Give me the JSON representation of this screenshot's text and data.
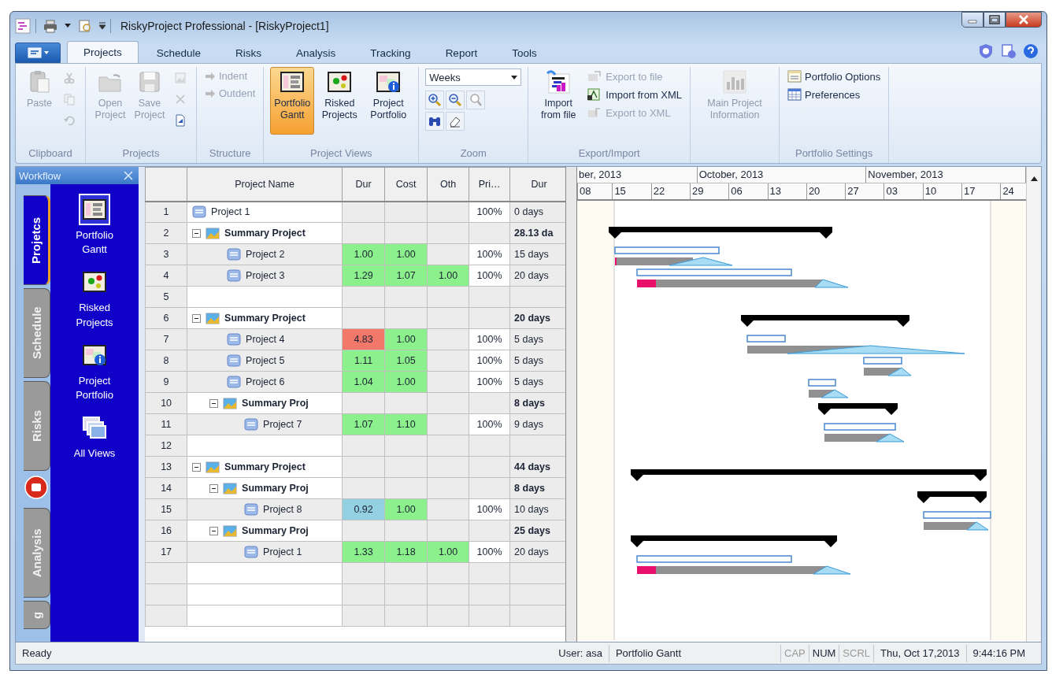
{
  "window": {
    "title": "RiskyProject Professional - [RiskyProject1]"
  },
  "ribbon_tabs": [
    {
      "label": "Projects",
      "selected": true
    },
    {
      "label": "Schedule",
      "selected": false
    },
    {
      "label": "Risks",
      "selected": false
    },
    {
      "label": "Analysis",
      "selected": false
    },
    {
      "label": "Tracking",
      "selected": false
    },
    {
      "label": "Report",
      "selected": false
    },
    {
      "label": "Tools",
      "selected": false
    }
  ],
  "ribbon": {
    "groups": [
      {
        "label": "Clipboard",
        "items": [
          {
            "kind": "large",
            "label": "Paste",
            "disabled": true
          },
          {
            "kind": "icon",
            "disabled": true
          },
          {
            "kind": "icon",
            "disabled": true
          },
          {
            "kind": "icon",
            "disabled": true
          }
        ]
      },
      {
        "label": "Projects",
        "items": [
          {
            "kind": "large",
            "label": "Open Project",
            "disabled": true
          },
          {
            "kind": "large",
            "label": "Save Project",
            "disabled": true
          },
          {
            "kind": "icon",
            "disabled": true
          },
          {
            "kind": "icon",
            "disabled": true
          },
          {
            "kind": "icon",
            "disabled": false
          }
        ]
      },
      {
        "label": "Structure",
        "items": [
          {
            "kind": "small",
            "label": "Indent",
            "disabled": true
          },
          {
            "kind": "small",
            "label": "Outdent",
            "disabled": true
          }
        ]
      },
      {
        "label": "Project Views",
        "items": [
          {
            "kind": "large",
            "label": "Portfolio Gantt",
            "disabled": false,
            "selected": true
          },
          {
            "kind": "large",
            "label": "Risked Projects",
            "disabled": false,
            "selected": false
          },
          {
            "kind": "large",
            "label": "Project Portfolio",
            "disabled": false,
            "selected": false
          }
        ]
      },
      {
        "label": "Zoom",
        "items": [
          {
            "kind": "dropdown",
            "value": "Weeks"
          },
          {
            "kind": "icon",
            "disabled": false
          },
          {
            "kind": "icon",
            "disabled": false
          },
          {
            "kind": "icon",
            "disabled": false
          },
          {
            "kind": "icon",
            "disabled": false
          },
          {
            "kind": "icon",
            "disabled": false
          }
        ]
      },
      {
        "label": "Export/Import",
        "items": [
          {
            "kind": "large",
            "label": "Import from file",
            "disabled": false
          },
          {
            "kind": "small",
            "label": "Export to file",
            "disabled": true
          },
          {
            "kind": "small",
            "label": "Import from XML",
            "disabled": false
          },
          {
            "kind": "small",
            "label": "Export to XML",
            "disabled": true
          }
        ]
      },
      {
        "items": [
          {
            "kind": "large",
            "label": "Main Project Information",
            "disabled": true
          }
        ]
      },
      {
        "label": "Portfolio Settings",
        "items": [
          {
            "kind": "small",
            "label": "Portfolio Options",
            "disabled": false
          },
          {
            "kind": "small",
            "label": "Preferences",
            "disabled": false
          }
        ]
      }
    ]
  },
  "workflow": {
    "title": "Workflow",
    "tabs": [
      {
        "label": "Projetcs",
        "selected": true
      },
      {
        "label": "Schedule",
        "selected": false
      },
      {
        "label": "Risks",
        "selected": false
      },
      {
        "label": "Analysis",
        "selected": false
      },
      {
        "label": "g",
        "selected": false
      }
    ],
    "items": [
      {
        "label": "Portfolio Gantt",
        "selected": true
      },
      {
        "label": "Risked Projects",
        "selected": false
      },
      {
        "label": "Project Portfolio",
        "selected": false
      },
      {
        "label": "All Views",
        "selected": false
      }
    ]
  },
  "table": {
    "columns": [
      "Project Name",
      "Dur",
      "Cost",
      "Oth",
      "Pri…",
      "Dur"
    ],
    "rows": [
      {
        "num": "1",
        "kind": "project",
        "name": "Project 1",
        "pri": "100%",
        "duration": "0 days"
      },
      {
        "num": "2",
        "kind": "summary",
        "name": "Summary Project",
        "expanded": true,
        "duration": "28.13 da",
        "children": [
          {
            "num": "3",
            "kind": "project",
            "name": "Project 2",
            "dur": {
              "value": "1.00",
              "color": "#8cf08c"
            },
            "cost": {
              "value": "1.00",
              "color": "#8cf08c"
            },
            "pri": "100%",
            "duration": "15 days"
          },
          {
            "num": "4",
            "kind": "project",
            "name": "Project 3",
            "dur": {
              "value": "1.29",
              "color": "#8cf08c"
            },
            "cost": {
              "value": "1.07",
              "color": "#8cf08c"
            },
            "other": {
              "value": "1.00",
              "color": "#8cf08c"
            },
            "pri": "100%",
            "duration": "20 days"
          }
        ]
      },
      {
        "num": "5",
        "kind": "blank"
      },
      {
        "num": "6",
        "kind": "summary",
        "name": "Summary Project",
        "expanded": true,
        "duration": "20 days",
        "children": [
          {
            "num": "7",
            "kind": "project",
            "name": "Project 4",
            "dur": {
              "value": "4.83",
              "color": "#f2786a"
            },
            "cost": {
              "value": "1.00",
              "color": "#8cf08c"
            },
            "pri": "100%",
            "duration": "5 days"
          },
          {
            "num": "8",
            "kind": "project",
            "name": "Project 5",
            "dur": {
              "value": "1.11",
              "color": "#8cf08c"
            },
            "cost": {
              "value": "1.05",
              "color": "#8cf08c"
            },
            "pri": "100%",
            "duration": "5 days"
          },
          {
            "num": "9",
            "kind": "project",
            "name": "Project 6",
            "dur": {
              "value": "1.04",
              "color": "#8cf08c"
            },
            "cost": {
              "value": "1.00",
              "color": "#8cf08c"
            },
            "pri": "100%",
            "duration": "5 days"
          },
          {
            "num": "10",
            "kind": "summary",
            "name": "Summary Proj",
            "expanded": true,
            "duration": "8 days",
            "children": [
              {
                "num": "11",
                "kind": "project",
                "name": "Project 7",
                "dur": {
                  "value": "1.07",
                  "color": "#8cf08c"
                },
                "cost": {
                  "value": "1.10",
                  "color": "#8cf08c"
                },
                "pri": "100%",
                "duration": "9 days"
              }
            ]
          }
        ]
      },
      {
        "num": "12",
        "kind": "blank"
      },
      {
        "num": "13",
        "kind": "summary",
        "name": "Summary Project",
        "expanded": true,
        "duration": "44 days",
        "children": [
          {
            "num": "14",
            "kind": "summary",
            "name": "Summary Proj",
            "expanded": true,
            "duration": "8 days",
            "children": [
              {
                "num": "15",
                "kind": "project",
                "name": "Project 8",
                "dur": {
                  "value": "0.92",
                  "color": "#92d0e2"
                },
                "cost": {
                  "value": "1.00",
                  "color": "#8cf08c"
                },
                "pri": "100%",
                "duration": "10 days"
              }
            ]
          },
          {
            "num": "16",
            "kind": "summary",
            "name": "Summary Proj",
            "expanded": true,
            "duration": "25 days",
            "children": [
              {
                "num": "17",
                "kind": "project",
                "name": "Project 1",
                "dur": {
                  "value": "1.33",
                  "color": "#8cf08c"
                },
                "cost": {
                  "value": "1.18",
                  "color": "#8cf08c"
                },
                "other": {
                  "value": "1.00",
                  "color": "#8cf08c"
                },
                "pri": "100%",
                "duration": "20 days"
              }
            ]
          }
        ]
      }
    ]
  },
  "timeline": {
    "months": [
      "ber, 2013",
      "October, 2013",
      "November, 2013"
    ],
    "days": [
      "08",
      "15",
      "22",
      "29",
      "06",
      "13",
      "20",
      "27",
      "03",
      "10",
      "17",
      "24"
    ]
  },
  "status_bar": {
    "message": "Ready",
    "user": "User: asa",
    "view": "Portfolio Gantt",
    "indicators": [
      {
        "label": "CAP",
        "on": false
      },
      {
        "label": "NUM",
        "on": true
      },
      {
        "label": "SCRL",
        "on": false
      }
    ],
    "date": "Thu, Oct 17,2013",
    "time": "9:44:16 PM"
  }
}
